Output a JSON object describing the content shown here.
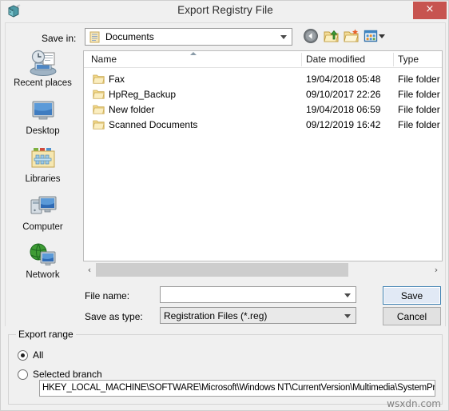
{
  "window": {
    "title": "Export Registry File",
    "app_icon": "registry-editor-icon",
    "close_label": "×",
    "close_color": "#c75450"
  },
  "savein": {
    "label": "Save in:",
    "value": "Documents",
    "icon": "documents-folder-icon"
  },
  "toolbar": {
    "back": "back-icon",
    "up": "up-one-level-icon",
    "new_folder": "new-folder-icon",
    "views": "views-icon"
  },
  "places": {
    "items": [
      {
        "label": "Recent places",
        "icon": "recent-places-icon"
      },
      {
        "label": "Desktop",
        "icon": "desktop-icon"
      },
      {
        "label": "Libraries",
        "icon": "libraries-icon"
      },
      {
        "label": "Computer",
        "icon": "computer-icon"
      },
      {
        "label": "Network",
        "icon": "network-icon"
      }
    ]
  },
  "filelist": {
    "columns": [
      "Name",
      "Date modified",
      "Type"
    ],
    "sort_column": "Name",
    "sort_direction": "ascending",
    "rows": [
      {
        "name": "Fax",
        "date": "19/04/2018 05:48",
        "type": "File folder"
      },
      {
        "name": "HpReg_Backup",
        "date": "09/10/2017 22:26",
        "type": "File folder"
      },
      {
        "name": "New folder",
        "date": "19/04/2018 06:59",
        "type": "File folder"
      },
      {
        "name": "Scanned Documents",
        "date": "09/12/2019 16:42",
        "type": "File folder"
      }
    ]
  },
  "scrollbar": {
    "left_arrow": "‹",
    "right_arrow": "›"
  },
  "form": {
    "filename_label": "File name:",
    "filename_value": "",
    "filename_placeholder": "",
    "savetype_label": "Save as type:",
    "savetype_value": "Registration Files (*.reg)",
    "save_label": "Save",
    "cancel_label": "Cancel"
  },
  "export_range": {
    "legend": "Export range",
    "options": [
      {
        "label": "All",
        "selected": true
      },
      {
        "label": "Selected branch",
        "selected": false
      }
    ],
    "branch_path": "HKEY_LOCAL_MACHINE\\SOFTWARE\\Microsoft\\Windows NT\\CurrentVersion\\Multimedia\\SystemProfile"
  },
  "watermark": "wsxdn.com"
}
